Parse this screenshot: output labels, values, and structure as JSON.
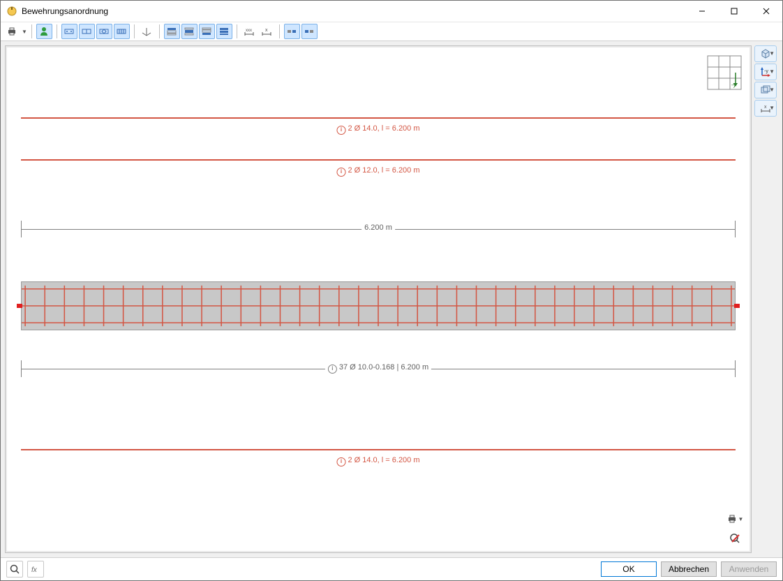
{
  "window": {
    "title": "Bewehrungsanordnung"
  },
  "toolbar": {
    "icons": [
      "print",
      "person",
      "btn-a",
      "btn-b",
      "btn-c",
      "btn-d",
      "btn-e",
      "axes",
      "al1",
      "al2",
      "al3",
      "al4",
      "dim-x",
      "dim-y",
      "sp1",
      "sp2"
    ]
  },
  "sidebar": {
    "items": [
      "view-3d",
      "axis-xy",
      "section",
      "scale"
    ]
  },
  "drawing": {
    "rebar_top_1": "2 Ø 14.0, l =  6.200 m",
    "rebar_top_2": "2 Ø 12.0, l =  6.200 m",
    "rebar_bottom": "2 Ø 14.0, l =  6.200 m",
    "stirrups": "37 Ø 10.0-0.168 | 6.200 m",
    "span_dim": "6.200 m",
    "axis_label": "-y"
  },
  "footer": {
    "ok": "OK",
    "cancel": "Abbrechen",
    "apply": "Anwenden"
  }
}
